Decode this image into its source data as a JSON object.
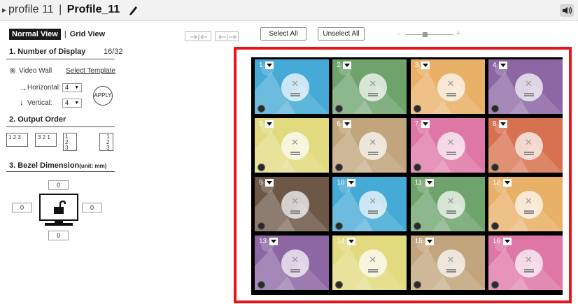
{
  "header": {
    "profile_prefix": "profile 11",
    "separator": "|",
    "profile_name": "Profile_11",
    "caret_icon": "triangle-right-icon",
    "edit_icon": "pencil-icon",
    "sound_icon": "speaker-icon"
  },
  "sidebar": {
    "tabs": {
      "normal": "Normal View",
      "separator": "|",
      "grid": "Grid View"
    },
    "section1": {
      "title": "1. Number of Display",
      "count": "16/32"
    },
    "video_wall_label": "Video Wall",
    "select_template": "Select Template",
    "horizontal_label": "Horizontal:",
    "horizontal_arrow": "→",
    "horizontal_value": "4",
    "vertical_label": "Vertical:",
    "vertical_arrow": "↓",
    "vertical_value": "4",
    "apply": "APPLY",
    "section2": {
      "title": "2. Output Order"
    },
    "orders": [
      "1 2 3",
      "3 2 1",
      "1\n2\n3",
      "1\n2\n3"
    ],
    "section3": {
      "title": "3. Bezel Dimension",
      "unit": "(unit: mm)"
    },
    "bezel": {
      "top": "0",
      "left": "0",
      "right": "0",
      "bottom": "0"
    }
  },
  "toolbar": {
    "select_all": "Select All",
    "unselect_all": "Unselect All",
    "zoom_minus": "-",
    "zoom_plus": "+",
    "zoom_level": 0.4
  },
  "colors": {
    "highlight": "#e8141b",
    "blue": "#45aad6",
    "green": "#6ea36c",
    "orange": "#e9b067",
    "purple": "#8c67a3",
    "yellow": "#e2da7e",
    "tan": "#c2a57c",
    "pink": "#df77a6",
    "coral": "#d8714f",
    "brown": "#6d5848"
  },
  "displays": [
    {
      "num": "1",
      "color": "#45aad6"
    },
    {
      "num": "2",
      "color": "#6ea36c"
    },
    {
      "num": "3",
      "color": "#e9b067"
    },
    {
      "num": "4",
      "color": "#8c67a3"
    },
    {
      "num": "5",
      "color": "#e2da7e"
    },
    {
      "num": "6",
      "color": "#c2a57c"
    },
    {
      "num": "7",
      "color": "#df77a6"
    },
    {
      "num": "8",
      "color": "#d8714f"
    },
    {
      "num": "9",
      "color": "#6d5848"
    },
    {
      "num": "10",
      "color": "#45aad6"
    },
    {
      "num": "11",
      "color": "#6ea36c"
    },
    {
      "num": "12",
      "color": "#e9b067"
    },
    {
      "num": "13",
      "color": "#8c67a3"
    },
    {
      "num": "14",
      "color": "#e2da7e"
    },
    {
      "num": "15",
      "color": "#c2a57c"
    },
    {
      "num": "16",
      "color": "#df77a6"
    }
  ]
}
